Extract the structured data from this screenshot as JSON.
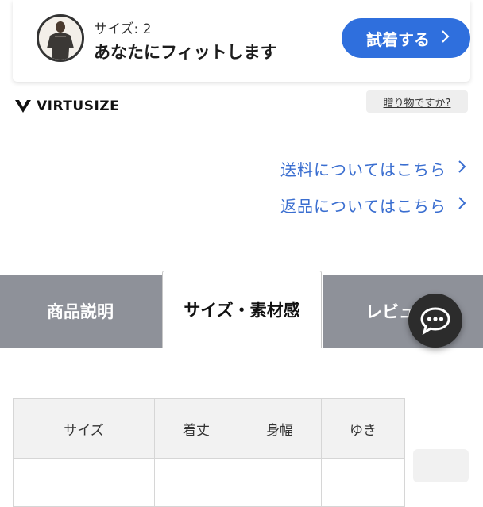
{
  "virtusize": {
    "size_text": "サイズ: 2",
    "fit_text": "あなたにフィットします",
    "try_button": "試着する",
    "try_chevron": ">",
    "logo_text": "VIRTUSIZE",
    "gift_link": "贈り物ですか?"
  },
  "info_links": [
    {
      "label": "送料についてはこちら",
      "chevron": ">"
    },
    {
      "label": "返品についてはこちら",
      "chevron": ">"
    }
  ],
  "tabs": [
    {
      "label": "商品説明",
      "active": false
    },
    {
      "label": "サイズ・素材感",
      "active": true
    },
    {
      "label": "レビュ",
      "active": false
    }
  ],
  "size_table": {
    "headers": [
      "サイズ",
      "着丈",
      "身幅",
      "ゆき"
    ]
  },
  "colors": {
    "accent_blue": "#2f6fdd",
    "link_blue": "#3a6ed0",
    "tab_gray": "#8e9199",
    "chat_bg": "#2c2c2c"
  }
}
